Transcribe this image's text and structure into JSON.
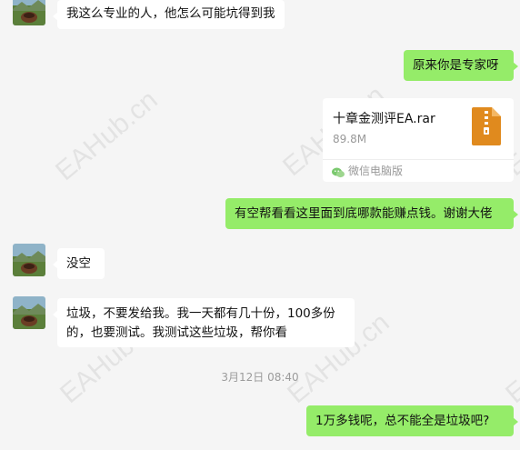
{
  "messages": [
    {
      "text": "我这么专业的人，他怎么可能坑得到我"
    },
    {
      "text": "原来你是专家呀"
    },
    {
      "text": "有空帮看看这里面到底哪款能赚点钱。谢谢大佬"
    },
    {
      "text": "没空"
    },
    {
      "text": "垃圾，不要发给我。我一天都有几十份，100多份的，也要测试。我测试这些垃圾，帮你看"
    },
    {
      "text": "1万多钱呢，总不能全是垃圾吧?"
    }
  ],
  "file": {
    "name": "十章金测评EA.rar",
    "size": "89.8M",
    "source": "微信电脑版",
    "icon": "zip-file-icon"
  },
  "timestamp": "3月12日 08:40",
  "watermark": "EAHub.cn",
  "colors": {
    "background": "#f5f5f5",
    "outgoing_bubble": "#95ec69",
    "incoming_bubble": "#ffffff",
    "zip_icon": "#e08a1e"
  }
}
